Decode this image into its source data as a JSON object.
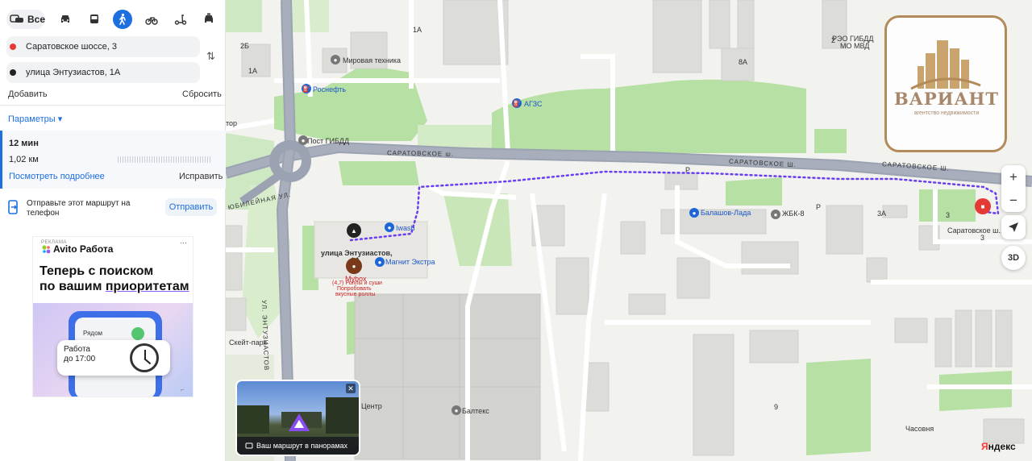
{
  "transport": {
    "all_label": "Все",
    "modes": [
      "car-icon",
      "bus-icon",
      "walk-icon",
      "bicycle-icon",
      "scooter-icon",
      "taxi-icon"
    ],
    "active_mode": "walk-icon"
  },
  "route_form": {
    "from": "Саратовское шоссе, 3",
    "to": "улица Энтузиастов, 1А",
    "add_label": "Добавить",
    "reset_label": "Сбросить",
    "params_label": "Параметры ▾"
  },
  "route": {
    "time": "12 мин",
    "distance": "1,02 км",
    "details_label": "Посмотреть подробнее",
    "fix_label": "Исправить"
  },
  "send": {
    "text": "Отправьте этот маршрут на телефон",
    "button": "Отправить"
  },
  "ad": {
    "tag": "РЕКЛАМА",
    "brand": "Avito Работа",
    "headline_1": "Теперь с поиском",
    "headline_2": "по вашим ",
    "headline_3": "приоритетам",
    "near": "Рядом",
    "card_1": "Работа",
    "card_2": "до 17:00",
    "menu": "⋯"
  },
  "map": {
    "labels": {
      "mirovaya": "Мировая техника",
      "rosneft": "Роснефть",
      "azs": "АГЗС",
      "post": "Пост ГИБДД",
      "rao": "РЭО ГИБДД",
      "mvd": "МО МВД",
      "saratov1": "САРАТОВСКОЕ ш.",
      "saratov2": "САРАТОВСКОЕ Ш.",
      "saratov3": "САРАТОВСКОЕ Ш.",
      "iwash": "Iwash",
      "magnit": "Магнит Экстра",
      "balashov": "Балашов-Лада",
      "zhbk": "ЖБК-8",
      "entuz_pin": "улица Энтузиастов,",
      "entuz_pin2": "1А",
      "mybox": "Mybox",
      "mybox_rating": "(4,7) Роллы и суши",
      "mybox_2": "Попробовать",
      "mybox_3": "вкусные роллы",
      "saratov_pin": "Саратовское ш.,",
      "saratov_pin2": "3",
      "skate": "Скейт-парк",
      "centr": "Центр",
      "baltex": "Балтекс",
      "chasovnya": "Часовня",
      "ul_entuz": "УЛ. ЭНТУЗИАСТОВ",
      "yubil": "ЮБИЛЕЙНАЯ УЛ.",
      "tor": "тор",
      "n2b": "2Б",
      "n1a": "1А",
      "n1a2": "1А",
      "n2": "2",
      "n8a": "8А",
      "n3a": "3А",
      "n3": "3",
      "nP": "Р",
      "nP2": "Р",
      "n9": "9"
    },
    "logo_name": "ВАРИАНТ",
    "logo_sub": "агентство недвижимости",
    "zoom_in": "+",
    "zoom_out": "−",
    "btn_3d": "3D",
    "pano_caption": "Ваш маршрут в панорамах",
    "pano_close": "✕",
    "yandex_1": "Я",
    "yandex_2": "ндекс"
  }
}
